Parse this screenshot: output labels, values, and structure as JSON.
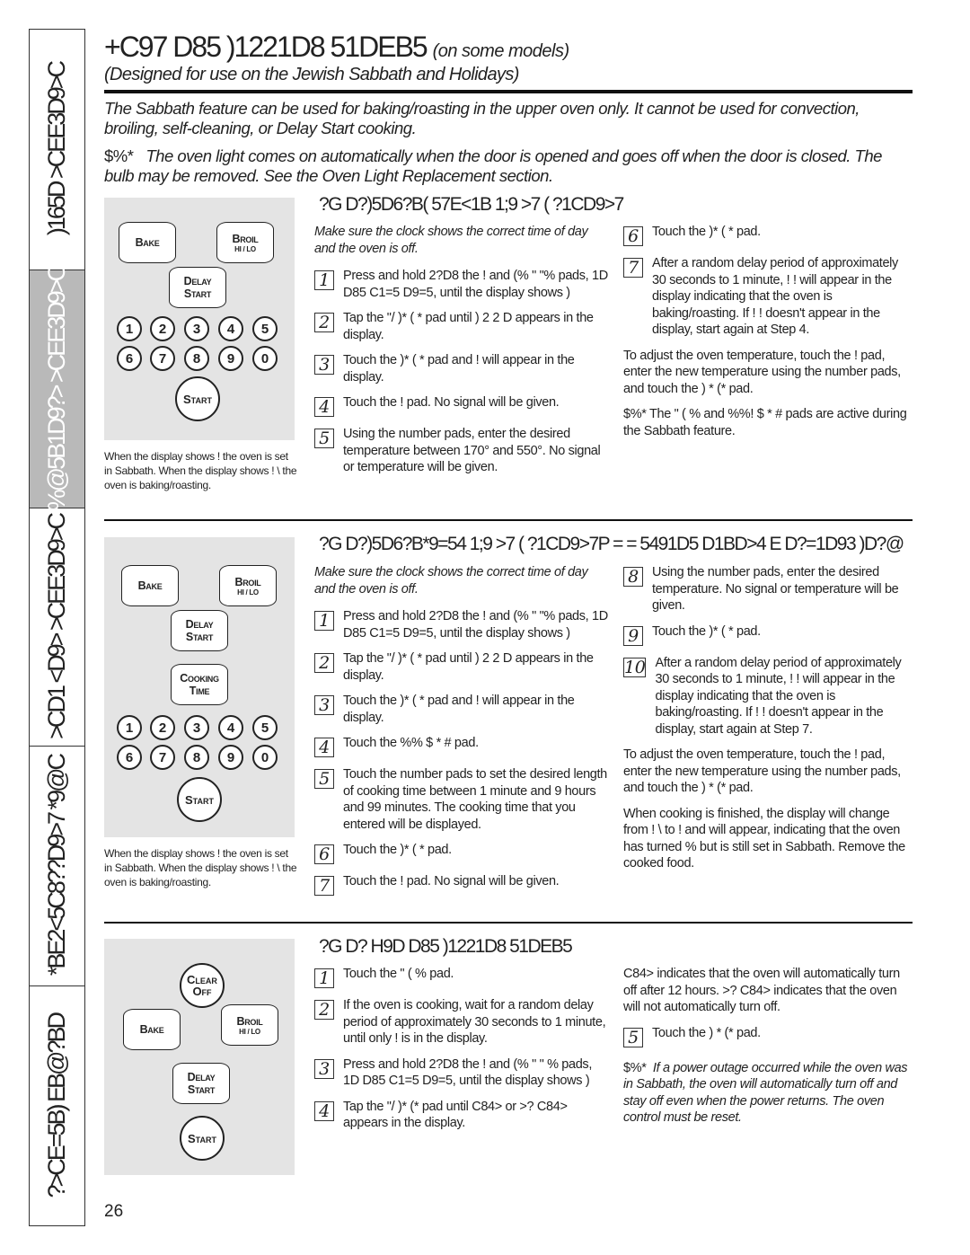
{
  "sidebar": {
    "tabs": [
      {
        "label": ")165D >CEE3D9>C"
      },
      {
        "label": "%@5B1D9?> >CEE3D9>C",
        "active": true
      },
      {
        "label": ">CD1 <D9> >CEE3D9>C"
      },
      {
        "label": "*BE2<5C8??D9>7 *9@C"
      },
      {
        "label": "?>CE=5B) EB@?BD"
      }
    ]
  },
  "header": {
    "title": "+C97 D85 )1221D8 51DEB5",
    "title_suffix": "(on some models)",
    "subtitle": "(Designed for use on the Jewish Sabbath and Holidays)"
  },
  "intro": {
    "text": "The Sabbath feature can be used for baking/roasting in the upper oven only. It cannot be used for convection, broiling, self-cleaning, or Delay Start cooking.",
    "note_label": "$%*",
    "note_text": "The oven light comes on automatically when the door is opened and goes off when the door is closed. The bulb may be removed. See the Oven Light Replacement section."
  },
  "sections": [
    {
      "title": "?G D?)5D6?B( 57E<1B 1;9 >7 ( ?1CD9>7",
      "keypad": {
        "bake": "Bake",
        "broil": "Broil",
        "broil_sub": "HI / LO",
        "delay1": "Delay",
        "delay2": "Start",
        "numbers": [
          "1",
          "2",
          "3",
          "4",
          "5",
          "6",
          "7",
          "8",
          "9",
          "0"
        ],
        "start": "Start"
      },
      "caption": "When the display shows !  the oven is set in Sabbath. When the display shows !    \\ the oven is baking/roasting.",
      "col1": [
        {
          "type": "intro",
          "text": "Make sure the clock shows the correct time of day and the oven is off."
        },
        {
          "type": "step",
          "n": "1",
          "text": "Press and hold 2?D8 the  !      and  (% \"      \"% pads, 1D D85 C1=5 D9=5, until the display shows )"
        },
        {
          "type": "step",
          "n": "2",
          "text": "Tap the    \"/    )*  (  *  pad until ) 2   2 D appears in the display."
        },
        {
          "type": "step",
          "n": "3",
          "text": "Touch the )*  (  *  pad and !   will appear in the display."
        },
        {
          "type": "step",
          "n": "4",
          "text": "Touch the   !       pad. No signal will be given."
        },
        {
          "type": "step",
          "n": "5",
          "text": "Using the number pads, enter the desired temperature between 170° and 550°. No signal or temperature will be given."
        }
      ],
      "col2": [
        {
          "type": "step",
          "n": "6",
          "text": "Touch the )*  (    *  pad."
        },
        {
          "type": "step",
          "n": "7",
          "text": "After a random delay period of approximately 30 seconds to 1 minute, !     ! will appear in the display indicating that the oven is baking/roasting. If !     ! doesn't appear in the display, start again at Step 4."
        },
        {
          "type": "para",
          "text": "To adjust the oven temperature, touch the    !       pad, enter the new temperature using the number pads, and touch the ) * (*    pad."
        },
        {
          "type": "para",
          "text": "$%*  The   \" ( %        and  %%! $    * #    pads are active during the Sabbath feature."
        }
      ]
    },
    {
      "title": "?G D?)5D6?B*9=54 1;9 >7 ( ?1CD9>7P = = 5491D5 D1BD>4 E D?=1D93 )D?@",
      "keypad": {
        "bake": "Bake",
        "broil": "Broil",
        "broil_sub": "HI / LO",
        "delay1": "Delay",
        "delay2": "Start",
        "cook1": "Cooking",
        "cook2": "Time",
        "numbers": [
          "1",
          "2",
          "3",
          "4",
          "5",
          "6",
          "7",
          "8",
          "9",
          "0"
        ],
        "start": "Start"
      },
      "caption": "When the display shows !  the oven is set in Sabbath. When the display shows !    \\ the oven is baking/roasting.",
      "col1": [
        {
          "type": "intro",
          "text": "Make sure the clock shows the correct time of day and the oven is off."
        },
        {
          "type": "step",
          "n": "1",
          "text": "Press and hold 2?D8 the  !      and  (% \"      \"% pads, 1D D85 C1=5 D9=5, until the display shows )"
        },
        {
          "type": "step",
          "n": "2",
          "text": "Tap the    \"/    )*  (  *  pad until ) 2   2 D appears in the display."
        },
        {
          "type": "step",
          "n": "3",
          "text": "Touch the )*  (  *  pad and !   will appear in the display."
        },
        {
          "type": "step",
          "n": "4",
          "text": "Touch the   %%  $     * #     pad."
        },
        {
          "type": "step",
          "n": "5",
          "text": "Touch the number pads to set the desired length of cooking time between 1 minute and 9 hours and 99 minutes. The cooking time that you entered will be displayed."
        },
        {
          "type": "step",
          "n": "6",
          "text": "Touch the )*  (  *  pad."
        },
        {
          "type": "step",
          "n": "7",
          "text": "Touch the   !       pad. No signal will be given."
        }
      ],
      "col2": [
        {
          "type": "step",
          "n": "8",
          "text": "Using the number pads, enter the desired temperature. No signal or temperature will be given."
        },
        {
          "type": "step",
          "n": "9",
          "text": "Touch the )*  (    *  pad."
        },
        {
          "type": "step",
          "n": "10",
          "text": "After a random delay period of approximately 30 seconds to 1 minute, !     ! will appear in the display indicating that the oven is baking/roasting. If !     ! doesn't appear in the display, start again at Step 7."
        },
        {
          "type": "para",
          "text": "To adjust the oven temperature, touch the    !       pad, enter the new temperature using the number pads, and touch the ) * (*    pad."
        },
        {
          "type": "para",
          "text": "When cooking is finished, the display will change from !     \\ to !   and        will appear, indicating that the oven has turned %     but is still set in Sabbath. Remove the cooked food."
        }
      ]
    },
    {
      "title": "?G D? H9D D85 )1221D8 51DEB5",
      "keypad": {
        "clear1": "Clear",
        "clear2": "Off",
        "bake": "Bake",
        "broil": "Broil",
        "broil_sub": "HI / LO",
        "delay1": "Delay",
        "delay2": "Start",
        "start": "Start"
      },
      "col1": [
        {
          "type": "step",
          "n": "1",
          "text": "Touch the  \"     (     %    pad."
        },
        {
          "type": "step",
          "n": "2",
          "text": "If the oven is cooking, wait for a random delay period of approximately 30 seconds to 1 minute, until only !   is in the display."
        },
        {
          "type": "step",
          "n": "3",
          "text": "Press and hold 2?D8 the  !      and  (%  \"      \" % pads, 1D D85 C1=5 D9=5, until the display shows )"
        },
        {
          "type": "step",
          "n": "4",
          "text": "Tap the    \"/   )*   (*  pad until      C84> or >? C84> appears in the display."
        }
      ],
      "col2": [
        {
          "type": "para",
          "text": "      C84> indicates that the oven will automatically turn off after 12 hours. >? C84> indicates that the oven will not automatically turn off."
        },
        {
          "type": "step",
          "n": "5",
          "text": "Touch the ) * (*     pad."
        },
        {
          "type": "note",
          "label": "$%*",
          "text": "If a power outage occurred while the oven was in Sabbath, the oven will automatically turn off and stay off even when the power returns. The oven control must be reset."
        }
      ]
    }
  ],
  "page_number": "26"
}
